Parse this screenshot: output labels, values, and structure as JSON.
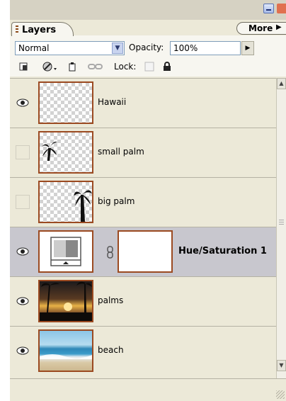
{
  "panel": {
    "tab_label": "Layers",
    "menu_button_label": "More",
    "blend_mode": {
      "selected": "Normal"
    },
    "opacity": {
      "label": "Opacity:",
      "value": "100%"
    },
    "lock_label": "Lock:"
  },
  "layers": [
    {
      "name": "Hawaii",
      "visible": true,
      "thumbnail": "transparent-checker-empty"
    },
    {
      "name": "small palm",
      "visible": false,
      "thumbnail": "small-palm-silhouette"
    },
    {
      "name": "big palm",
      "visible": false,
      "thumbnail": "big-palm-silhouette"
    },
    {
      "name": "Hue/Saturation 1",
      "visible": true,
      "selected": true,
      "linked_mask": true,
      "thumbnail": "adjustment-layer-icon"
    },
    {
      "name": "palms",
      "visible": true,
      "thumbnail": "palms-sunset-photo"
    },
    {
      "name": "beach",
      "visible": true,
      "thumbnail": "beach-photo"
    }
  ],
  "icons": [
    "minimize-icon",
    "close-icon",
    "menu-arrow-icon",
    "dropdown-arrow-icon",
    "opacity-slider-arrow-icon",
    "layer-style-icon",
    "mask-icon",
    "new-fill-icon",
    "link-icon",
    "lock-transparency-icon",
    "lock-all-icon",
    "eye-icon",
    "chain-link-icon",
    "scroll-up-icon",
    "scroll-down-icon"
  ],
  "colors": {
    "thumb_border": "#9b4a21",
    "selected_row": "#c8c7ce",
    "panel_bg": "#ece9d8"
  }
}
